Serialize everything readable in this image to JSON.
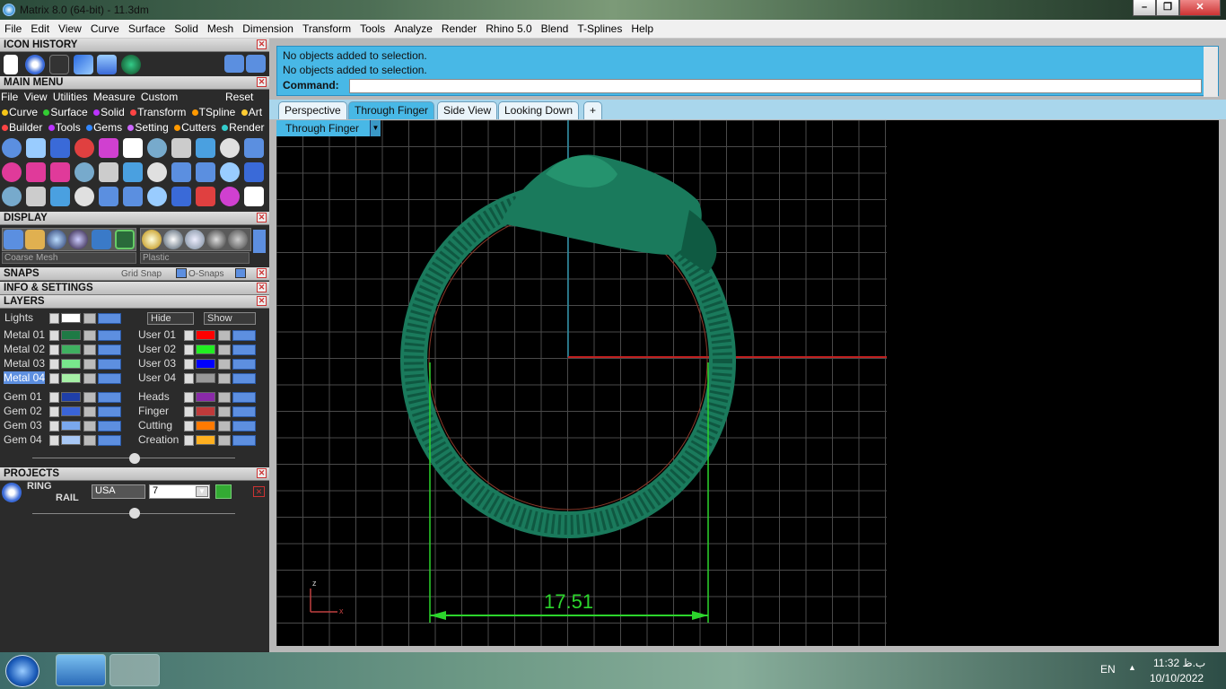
{
  "window": {
    "title": "Matrix 8.0 (64-bit) - 11.3dm",
    "minimize": "–",
    "restore": "❐",
    "close": "✕"
  },
  "menu": [
    "File",
    "Edit",
    "View",
    "Curve",
    "Surface",
    "Solid",
    "Mesh",
    "Dimension",
    "Transform",
    "Tools",
    "Analyze",
    "Render",
    "Rhino 5.0",
    "Blend",
    "T-Splines",
    "Help"
  ],
  "panels": {
    "icon_history": "ICON HISTORY",
    "main_menu": "MAIN MENU",
    "display": "DISPLAY",
    "snaps": "SNAPS",
    "info": "INFO & SETTINGS",
    "layers": "LAYERS",
    "projects": "PROJECTS"
  },
  "main_menu_row": [
    "File",
    "View",
    "Utilities",
    "Measure",
    "Custom"
  ],
  "main_menu_reset": "Reset",
  "builders_row1": [
    "Curve",
    "Surface",
    "Solid",
    "Transform",
    "TSpline",
    "Art"
  ],
  "builders_row2": [
    "Builder",
    "Tools",
    "Gems",
    "Setting",
    "Cutters",
    "Render"
  ],
  "display_opts": {
    "mesh": "Coarse Mesh",
    "material": "Plastic"
  },
  "snaps": {
    "grid": "Grid Snap",
    "osnaps": "O-Snaps"
  },
  "layers": {
    "lights": "Lights",
    "hide": "Hide",
    "show": "Show",
    "left": [
      {
        "name": "Metal 01",
        "color": "#1e7a45"
      },
      {
        "name": "Metal 02",
        "color": "#3fb060"
      },
      {
        "name": "Metal 03",
        "color": "#78e68c"
      },
      {
        "name": "Metal 04",
        "color": "#a6f0a6"
      },
      {
        "name": "Gem 01",
        "color": "#1f3fa8"
      },
      {
        "name": "Gem 02",
        "color": "#3a64d8"
      },
      {
        "name": "Gem 03",
        "color": "#7aa8ee"
      },
      {
        "name": "Gem 04",
        "color": "#a8c8f5"
      }
    ],
    "right": [
      {
        "name": "User 01",
        "color": "#ff0000"
      },
      {
        "name": "User 02",
        "color": "#22ee22"
      },
      {
        "name": "User 03",
        "color": "#0000ff"
      },
      {
        "name": "User 04",
        "color": "#999999"
      },
      {
        "name": "Heads",
        "color": "#8a2aa8"
      },
      {
        "name": "Finger",
        "color": "#c03a3a"
      },
      {
        "name": "Cutting",
        "color": "#ff7a00"
      },
      {
        "name": "Creation",
        "color": "#ffb020"
      }
    ]
  },
  "projects": {
    "line1": "RING",
    "line2": "RAIL",
    "country": "USA",
    "size": "7"
  },
  "command": {
    "line1": "No objects added to selection.",
    "line2": "No objects added to selection.",
    "label": "Command:"
  },
  "tabs": [
    "Perspective",
    "Through Finger",
    "Side View",
    "Looking Down",
    "+"
  ],
  "viewport": {
    "label": "Through Finger",
    "dimension": "17.51",
    "axis_z": "z",
    "axis_x": "x"
  },
  "tray": {
    "lang": "EN",
    "time": "11:32 ب.ظ",
    "date": "10/10/2022"
  }
}
